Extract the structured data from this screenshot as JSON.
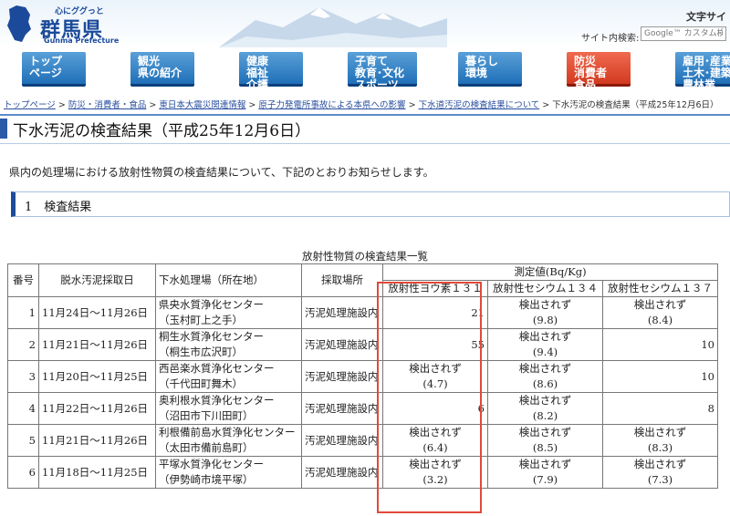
{
  "header": {
    "logo_small": "心にググっと",
    "logo_big": "群馬県",
    "logo_en": "Gunma Prefecture",
    "text_size": "文字サイ",
    "search_label": "サイト内検索:",
    "search_placeholder": "Google™ カスタム検索"
  },
  "nav": [
    {
      "label": "トップ\nページ",
      "color": "blue"
    },
    {
      "label": "観光\n県の紹介",
      "color": "blue"
    },
    {
      "label": "健康\n福祉\n介護",
      "color": "blue"
    },
    {
      "label": "子育て\n教育･文化\nスポーツ",
      "color": "blue"
    },
    {
      "label": "暮らし\n環境",
      "color": "blue"
    },
    {
      "label": "防災\n消費者\n食品",
      "color": "red"
    },
    {
      "label": "雇用･産業\n土木･建築\n農林業",
      "color": "blue"
    }
  ],
  "breadcrumb": {
    "items": [
      "トップページ",
      "防災・消費者・食品",
      "東日本大震災関連情報",
      "原子力発電所事故による本県への影響",
      "下水道汚泥の検査結果について"
    ],
    "current": "下水汚泥の検査結果（平成25年12月6日）",
    "sep": " > "
  },
  "page_title": "下水汚泥の検査結果（平成25年12月6日）",
  "intro": "県内の処理場における放射性物質の検査結果について、下記のとおりお知らせします。",
  "section_heading": "1　検査結果",
  "table": {
    "caption": "放射性物質の検査結果一覧",
    "headers": {
      "no": "番号",
      "date": "脱水汚泥採取日",
      "plant": "下水処理場（所在地）",
      "place": "採取場所",
      "measured": "測定値(Bq/Kg)",
      "i131": "放射性ヨウ素１３１",
      "cs134": "放射性セシウム１３４",
      "cs137": "放射性セシウム１３７"
    },
    "rows": [
      {
        "no": "1",
        "date": "11月24日～11月26日",
        "plant": "県央水質浄化センター",
        "loc": "（玉村町上之手）",
        "place": "汚泥処理施設内",
        "i131": {
          "t": "21",
          "s": ""
        },
        "cs134": {
          "t": "検出されず",
          "s": "(9.8)"
        },
        "cs137": {
          "t": "検出されず",
          "s": "(8.4)"
        }
      },
      {
        "no": "2",
        "date": "11月21日～11月26日",
        "plant": "桐生水質浄化センター",
        "loc": "（桐生市広沢町）",
        "place": "汚泥処理施設内",
        "i131": {
          "t": "55",
          "s": ""
        },
        "cs134": {
          "t": "検出されず",
          "s": "(9.4)"
        },
        "cs137": {
          "t": "10",
          "s": ""
        }
      },
      {
        "no": "3",
        "date": "11月20日～11月25日",
        "plant": "西邑楽水質浄化センター",
        "loc": "（千代田町舞木）",
        "place": "汚泥処理施設内",
        "i131": {
          "t": "検出されず",
          "s": "(4.7)"
        },
        "cs134": {
          "t": "検出されず",
          "s": "(8.6)"
        },
        "cs137": {
          "t": "10",
          "s": ""
        }
      },
      {
        "no": "4",
        "date": "11月22日～11月26日",
        "plant": "奥利根水質浄化センター",
        "loc": "（沼田市下川田町）",
        "place": "汚泥処理施設内",
        "i131": {
          "t": "6",
          "s": ""
        },
        "cs134": {
          "t": "検出されず",
          "s": "(8.2)"
        },
        "cs137": {
          "t": "8",
          "s": ""
        }
      },
      {
        "no": "5",
        "date": "11月21日～11月26日",
        "plant": "利根備前島水質浄化センター",
        "loc": "（太田市備前島町）",
        "place": "汚泥処理施設内",
        "i131": {
          "t": "検出されず",
          "s": "(6.4)"
        },
        "cs134": {
          "t": "検出されず",
          "s": "(8.5)"
        },
        "cs137": {
          "t": "検出されず",
          "s": "(8.3)"
        }
      },
      {
        "no": "6",
        "date": "11月18日～11月25日",
        "plant": "平塚水質浄化センター",
        "loc": "（伊勢崎市境平塚）",
        "place": "汚泥処理施設内",
        "i131": {
          "t": "検出されず",
          "s": "(3.2)"
        },
        "cs134": {
          "t": "検出されず",
          "s": "(7.9)"
        },
        "cs137": {
          "t": "検出されず",
          "s": "(7.3)"
        }
      }
    ]
  },
  "colors": {
    "nav_blue": "#1f6fb8",
    "nav_red": "#d23a20",
    "highlight": "#e04a3a",
    "title_bar": "#2a5aa8"
  }
}
